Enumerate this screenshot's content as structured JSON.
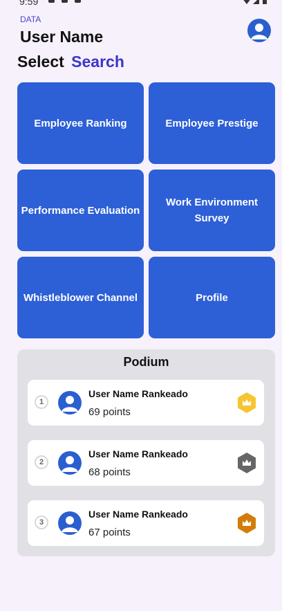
{
  "status": {
    "time": "9:59"
  },
  "header": {
    "data_label": "DATA",
    "user_name": "User Name",
    "select_label": "Select",
    "search_label": "Search"
  },
  "tiles": [
    {
      "label": "Employee Ranking"
    },
    {
      "label": "Employee Prestige"
    },
    {
      "label": "Performance Evaluation"
    },
    {
      "label": "Work Environment Survey"
    },
    {
      "label": "Whistleblower Channel"
    },
    {
      "label": "Profile"
    }
  ],
  "podium": {
    "title": "Podium",
    "entries": [
      {
        "rank": "1",
        "name": "User Name Rankeado",
        "points": "69 points",
        "medal_color": "#f7c531",
        "medal_icon": "crown-gold-icon"
      },
      {
        "rank": "2",
        "name": "User Name Rankeado",
        "points": "68 points",
        "medal_color": "#666666",
        "medal_icon": "crown-silver-icon"
      },
      {
        "rank": "3",
        "name": "User Name Rankeado",
        "points": "67 points",
        "medal_color": "#d37c0a",
        "medal_icon": "crown-bronze-icon"
      }
    ]
  },
  "colors": {
    "accent": "#2d5fd7",
    "search": "#3b36c9",
    "background": "#f6f1fb",
    "podium_bg": "#e1e0e5"
  }
}
